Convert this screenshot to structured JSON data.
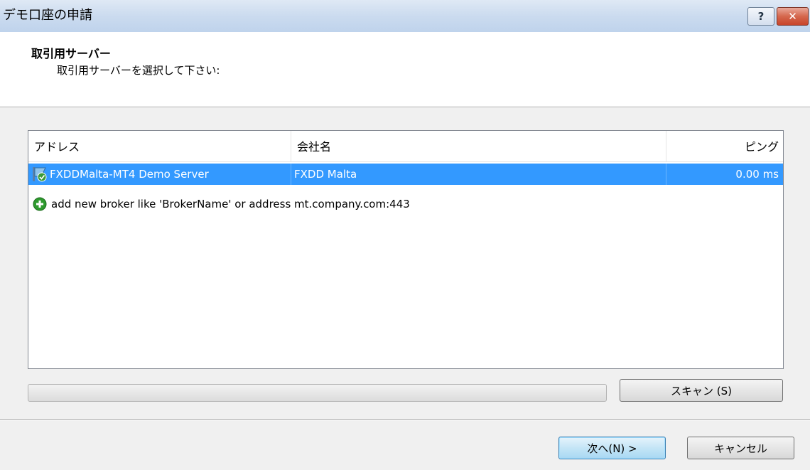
{
  "window": {
    "title": "デモ口座の申請",
    "help_label": "?",
    "close_label": "✕"
  },
  "header": {
    "title": "取引用サーバー",
    "subtitle": "取引用サーバーを選択して下さい:"
  },
  "server_list": {
    "columns": [
      "アドレス",
      "会社名",
      "ピング"
    ],
    "rows": [
      {
        "address": "FXDDMalta-MT4 Demo Server",
        "company": "FXDD Malta",
        "ping": "0.00 ms",
        "selected": true,
        "icon": "server-flag-icon"
      }
    ],
    "add_row": {
      "text": "add new broker like 'BrokerName' or address mt.company.com:443",
      "icon": "add-circle-icon"
    }
  },
  "scan_button": "スキャン (S)",
  "footer": {
    "next_label": "次へ(N) >",
    "cancel_label": "キャンセル"
  },
  "colors": {
    "selection": "#3399ff",
    "titlebar": "#cbdbef",
    "close_button": "#c9452a",
    "add_icon": "#2e9a2e"
  }
}
